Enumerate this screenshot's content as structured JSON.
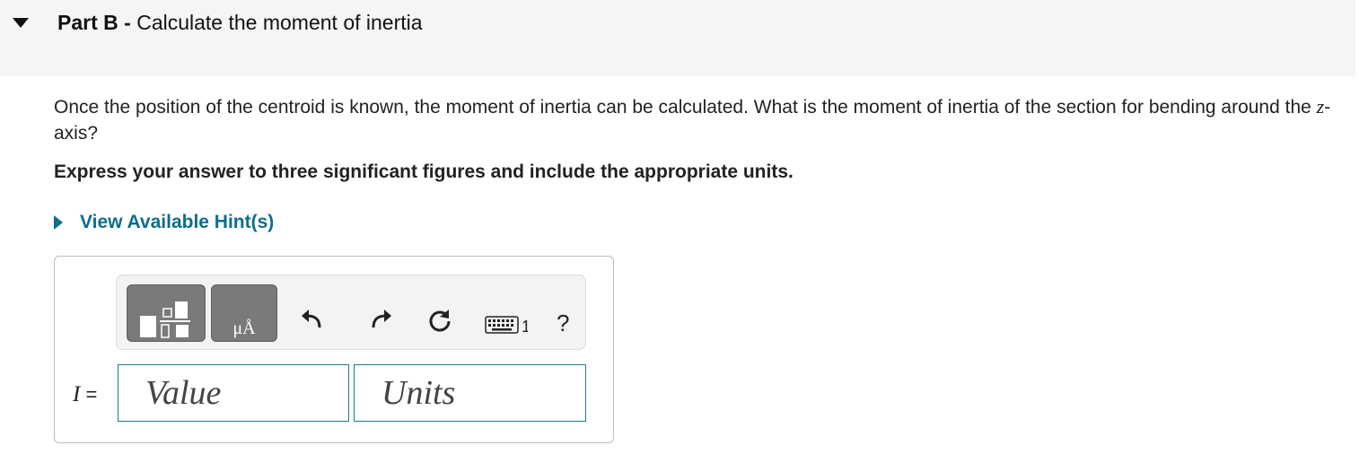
{
  "part": {
    "label": "Part B",
    "separator": "-",
    "title": "Calculate the moment of inertia"
  },
  "question": {
    "text_before": "Once the position of the centroid is known, the moment of inertia can be calculated. What is the moment of inertia of the section for bending around the ",
    "axis_var": "z",
    "text_after": "-axis?"
  },
  "instruction": "Express your answer to three significant figures and include the appropriate units.",
  "hint": {
    "label": "View Available Hint(s)"
  },
  "toolbar": {
    "units_glyph": "μÅ",
    "keyboard_suffix": "1",
    "help_label": "?"
  },
  "answer": {
    "variable": "I",
    "equals": "=",
    "value_placeholder": "Value",
    "units_placeholder": "Units"
  },
  "colors": {
    "accent": "#0b6e8c",
    "field_border": "#1a7f8a",
    "button_gray": "#7a7a7a"
  }
}
